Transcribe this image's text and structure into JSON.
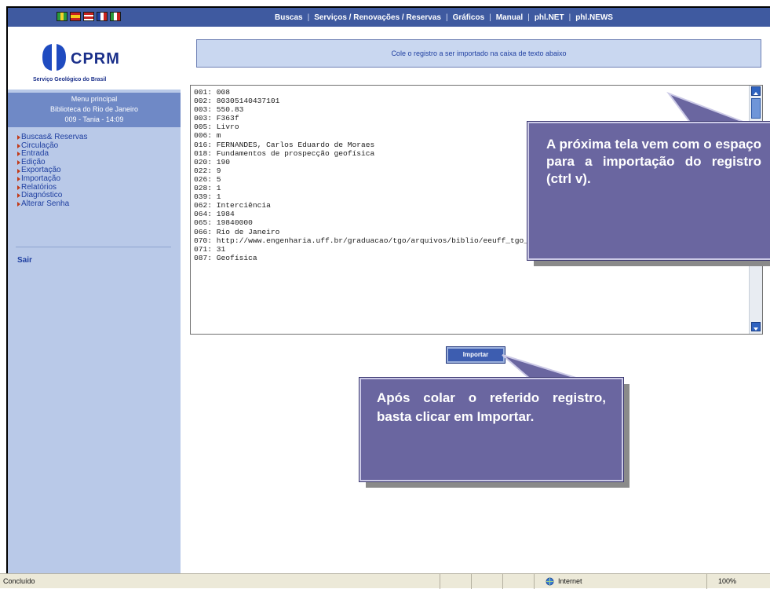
{
  "colors": {
    "topbar": "#3f5aa0",
    "sidebar": "#b9c9e8",
    "accent": "#1f3fa0",
    "callout": "#6a66a0",
    "menu_marker": "#c23a18"
  },
  "flags": [
    "brazil-flag",
    "spain-flag",
    "usa-flag",
    "france-flag",
    "italy-flag"
  ],
  "nav": {
    "items": [
      "Buscas",
      "Serviços / Renovações / Reservas",
      "Gráficos",
      "Manual",
      "phl.NET",
      "phl.NEWS"
    ],
    "separator": "|"
  },
  "logo": {
    "name": "CPRM",
    "subtitle": "Serviço Geológico do Brasil"
  },
  "menu_header": {
    "title": "Menu principal",
    "library": "Biblioteca do Rio de Janeiro",
    "session": "009 - Tania - 14:09"
  },
  "menu": [
    "Buscas& Reservas",
    "Circulação",
    "Entrada",
    "Edição",
    "Exportação",
    "Importação",
    "Relatórios",
    "Diagnóstico",
    "Alterar Senha"
  ],
  "logout": "Sair",
  "banner": "Cole o registro a ser importado na caixa de texto abaixo",
  "record_lines": [
    "001: 008",
    "002: 80305140437101",
    "003: 550.83",
    "003: F363f",
    "005: Livro",
    "006: m",
    "016: FERNANDES, Carlos Eduardo de Moraes",
    "018: Fundamentos de prospecção geofísica",
    "020: 190",
    "022: 9",
    "026: 5",
    "028: 1",
    "039: 1",
    "062: Interciência",
    "064: 1984",
    "065: 19840000",
    "066: Rio de Janeiro",
    "070: http://www.engenharia.uff.br/graduacao/tgo/arquivos/biblio/eeuff_tgo_c04379.jpg",
    "071: 31",
    "087: Geofísica"
  ],
  "import_button": "Importar",
  "callouts": {
    "next_screen": "A próxima tela vem com o espaço para a importação do registro (ctrl v).",
    "after_paste": "Após colar o referido registro, basta clicar em Importar."
  },
  "status": {
    "left": "Concluído",
    "zone": "Internet",
    "zoom": "100%"
  }
}
